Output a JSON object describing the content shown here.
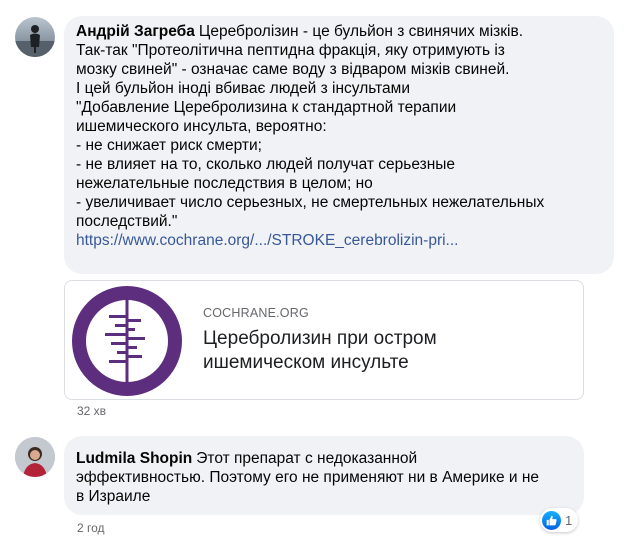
{
  "comments": [
    {
      "author": "Андрій Загреба",
      "lines": [
        "Церебролізин - це бульйон з свинячих мізків.",
        "Так-так \"Протеолітична пептидна фракція, яку отримують із",
        "мозку свиней\" - означає саме воду з відваром мізків свиней.",
        "І цей бульйон іноді вбиває людей з інсультами",
        "\"Добавление Церебролизина к стандартной терапии",
        "ишемического инсульта, вероятно:",
        "- не снижает риск смерти;",
        "- не влияет на то, сколько людей получат серьезные",
        "нежелательные последствия в целом; но",
        "- увеличивает число серьезных, не смертельных нежелательных",
        "последствий.\""
      ],
      "link": "https://www.cochrane.org/.../STROKE_cerebrolizin-pri...",
      "preview": {
        "domain": "COCHRANE.ORG",
        "title": "Церебролизин при остром ишемическом инсульте",
        "thumbnail": "cochrane-logo"
      },
      "time": "32 хв"
    },
    {
      "author": "Ludmila Shopin",
      "lines": [
        "Этот препарат с недоказанной",
        "эффективностью. Поэтому его не применяют ни в Америке и не",
        "в Израиле"
      ],
      "time": "2 год",
      "reactions": {
        "icon": "like-icon",
        "count": "1"
      }
    }
  ],
  "colors": {
    "bubble": "#f0f2f5",
    "link": "#385898",
    "meta": "#65676b",
    "cochrane_purple": "#5d2e7e",
    "like_blue": "#0a7cff"
  }
}
